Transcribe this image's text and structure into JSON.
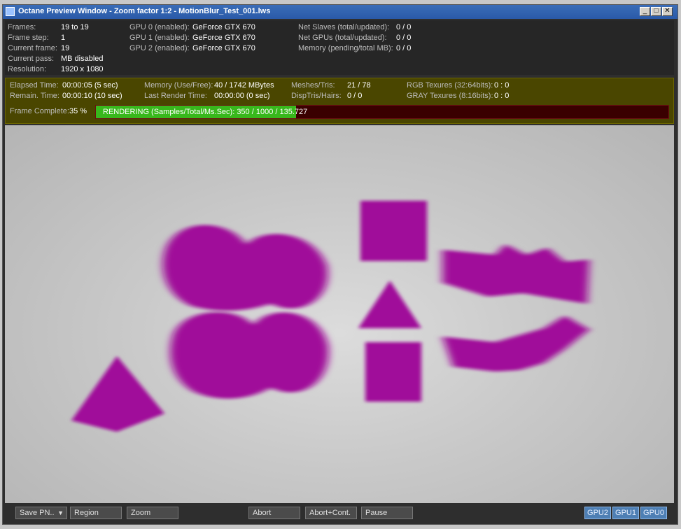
{
  "window": {
    "title": "Octane Preview Window - Zoom factor 1:2 - MotionBlur_Test_001.lws",
    "buttons": {
      "minimize": "_",
      "maximize": "□",
      "close": "✕"
    }
  },
  "info": {
    "left": [
      {
        "label": "Frames:",
        "value": "19 to 19"
      },
      {
        "label": "Frame step:",
        "value": "1"
      },
      {
        "label": "Current frame:",
        "value": "19"
      },
      {
        "label": "Current pass:",
        "value": "MB disabled"
      },
      {
        "label": "Resolution:",
        "value": "1920 x 1080"
      }
    ],
    "gpus": [
      {
        "label": "GPU  0 (enabled):",
        "value": "GeForce GTX 670"
      },
      {
        "label": "GPU  1 (enabled):",
        "value": "GeForce GTX 670"
      },
      {
        "label": "GPU  2 (enabled):",
        "value": "GeForce GTX 670"
      }
    ],
    "net": [
      {
        "label": "Net Slaves (total/updated):",
        "value": "0 / 0"
      },
      {
        "label": "Net GPUs (total/updated):",
        "value": "0 / 0"
      },
      {
        "label": "Memory (pending/total MB):",
        "value": "0 / 0"
      }
    ]
  },
  "stats": {
    "elapsed": {
      "label": "Elapsed Time:",
      "value": "00:00:05 (5 sec)"
    },
    "remain": {
      "label": "Remain. Time:",
      "value": "00:00:10 (10 sec)"
    },
    "memory": {
      "label": "Memory (Use/Free):",
      "value": "40 / 1742 MBytes"
    },
    "last_render": {
      "label": "Last Render Time:",
      "value": "00:00:00 (0 sec)"
    },
    "meshes": {
      "label": "Meshes/Tris:",
      "value": "21 / 78"
    },
    "disp": {
      "label": "DispTris/Hairs:",
      "value": "0 / 0"
    },
    "rgb": {
      "label": "RGB Texures (32:64bits):",
      "value": "0 : 0"
    },
    "gray": {
      "label": "GRAY Texures (8:16bits):",
      "value": "0 : 0"
    },
    "frame_complete": {
      "label": "Frame Complete:",
      "value": "35 %"
    },
    "progress_fraction": 0.35,
    "progress_text": "RENDERING (Samples/Total/Ms.Sec): 350 / 1000 / 135.727"
  },
  "toolbar": {
    "save": "Save PN..",
    "region": "Region",
    "zoom": "Zoom",
    "abort": "Abort",
    "abort_cont": "Abort+Cont.",
    "pause": "Pause",
    "gpu2": "GPU2",
    "gpu1": "GPU1",
    "gpu0": "GPU0"
  },
  "colors": {
    "object": "#a0109a",
    "progress": "#38b81c",
    "progress_bg": "#3a0000"
  }
}
